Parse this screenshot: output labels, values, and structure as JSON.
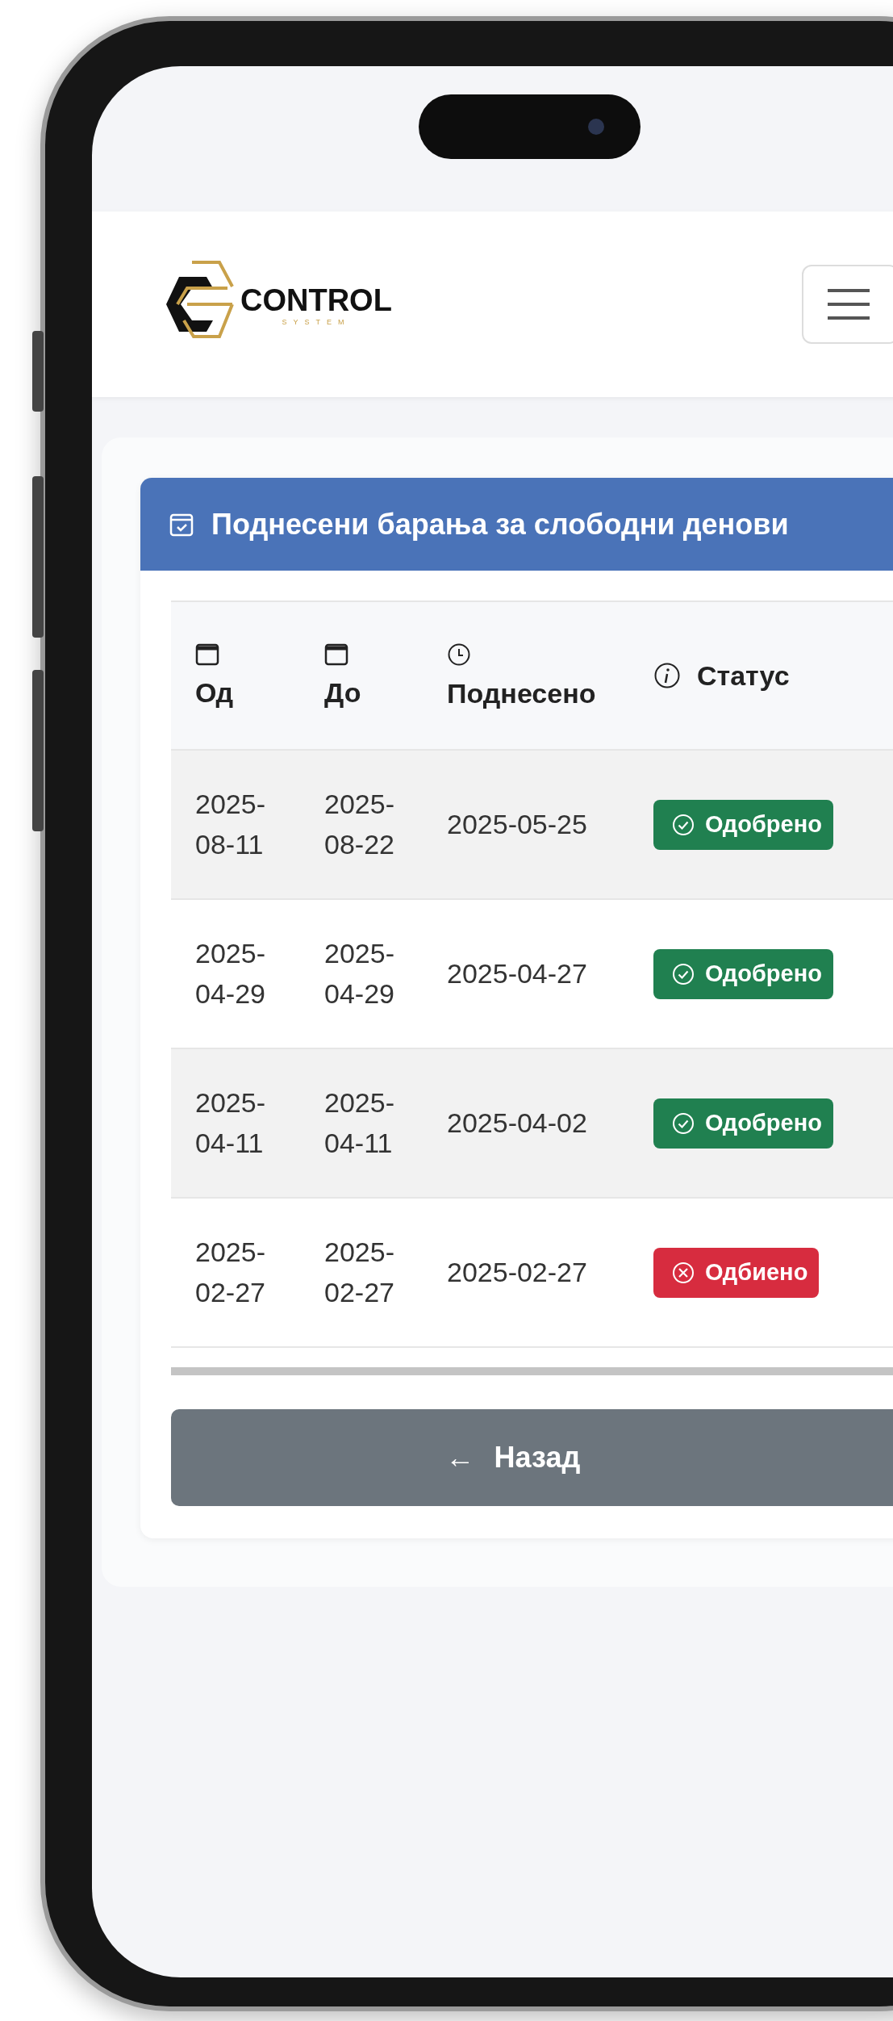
{
  "logo": {
    "name": "CONTROL",
    "tagline": "SYSTEM"
  },
  "card": {
    "title": "Поднесени барања за слободни денови"
  },
  "table": {
    "columns": [
      {
        "label": "Од",
        "kind": "calendar"
      },
      {
        "label": "До",
        "kind": "calendar"
      },
      {
        "label": "Поднесено",
        "kind": "clock"
      },
      {
        "label": "Статус",
        "kind": "info"
      }
    ],
    "rows": [
      {
        "from": "2025-\n08-11",
        "to": "2025-\n08-22",
        "submitted": "2025-05-25",
        "status": {
          "kind": "approved",
          "label": "Одобрено"
        }
      },
      {
        "from": "2025-\n04-29",
        "to": "2025-\n04-29",
        "submitted": "2025-04-27",
        "status": {
          "kind": "approved",
          "label": "Одобрено"
        }
      },
      {
        "from": "2025-\n04-11",
        "to": "2025-\n04-11",
        "submitted": "2025-04-02",
        "status": {
          "kind": "approved",
          "label": "Одобрено"
        }
      },
      {
        "from": "2025-\n02-27",
        "to": "2025-\n02-27",
        "submitted": "2025-02-27",
        "status": {
          "kind": "rejected",
          "label": "Одбиено"
        }
      }
    ]
  },
  "back_button": {
    "label": "Назад",
    "icon": "←"
  }
}
